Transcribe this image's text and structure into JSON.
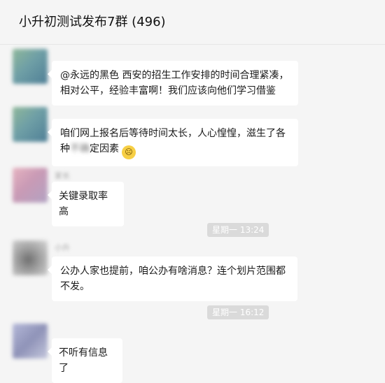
{
  "header": {
    "title": "小升初测试发布7群 (496)"
  },
  "messages": [
    {
      "sender": "",
      "text": "@永远的黑色 西安的招生工作安排的时间合理紧凑，相对公平，经验丰富啊！我们应该向他们学习借鉴"
    },
    {
      "sender": "",
      "text_a": "咱们网上报名后等待时间太长，人心惶惶，滋生了各种",
      "text_blur": "不确",
      "text_b": "定因素",
      "emoji": "crying-face-icon"
    },
    {
      "sender": "家长",
      "text": "关键录取率高"
    },
    {
      "sender": "小升",
      "text": "公办人家也提前，咱公办有啥消息？连个划片范围都不发。"
    },
    {
      "sender": "",
      "text": "不听有信息了"
    }
  ],
  "timestamps": [
    "星期一 13:24",
    "星期一 16:12"
  ],
  "colors": {
    "background": "#f5f5f5",
    "bubble": "#ffffff",
    "timestamp_bg": "#dadada"
  }
}
